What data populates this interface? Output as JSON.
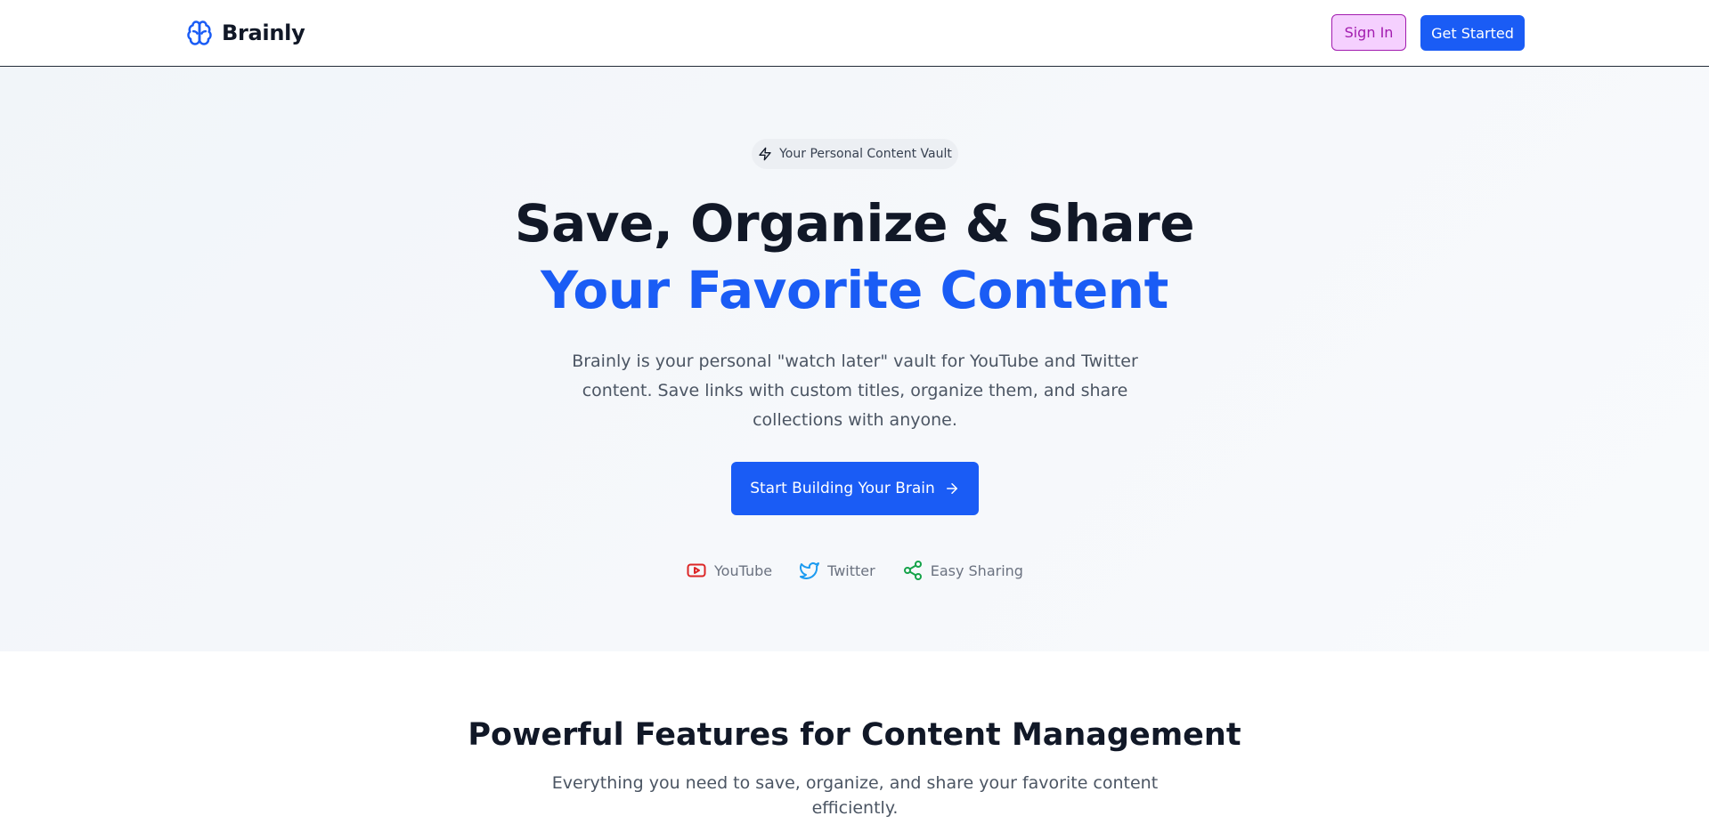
{
  "nav": {
    "brand": "Brainly",
    "brand_icon": "brain-icon",
    "signin_label": "Sign In",
    "getstarted_label": "Get Started"
  },
  "hero": {
    "badge_icon": "lightning-icon",
    "badge_label": "Your Personal Content Vault",
    "title_line1": "Save, Organize & Share",
    "title_line2": "Your Favorite Content",
    "description": "Brainly is your personal \"watch later\" vault for YouTube and Twitter content. Save links with custom titles, organize them, and share collections with anyone.",
    "cta_label": "Start Building Your Brain",
    "cta_icon": "arrow-right-icon",
    "tags": [
      {
        "label": "YouTube",
        "icon": "youtube-icon",
        "color": "#dc2626"
      },
      {
        "label": "Twitter",
        "icon": "twitter-icon",
        "color": "#1d9bf0"
      },
      {
        "label": "Easy Sharing",
        "icon": "share-icon",
        "color": "#16a34a"
      }
    ]
  },
  "features": {
    "title": "Powerful Features for Content Management",
    "subtitle": "Everything you need to save, organize, and share your favorite content efficiently."
  },
  "colors": {
    "primary": "#1a5cf5",
    "signin_border": "#a21caf",
    "signin_bg": "#f5d0fe",
    "heading": "#111827",
    "body_text": "#4b5563"
  }
}
